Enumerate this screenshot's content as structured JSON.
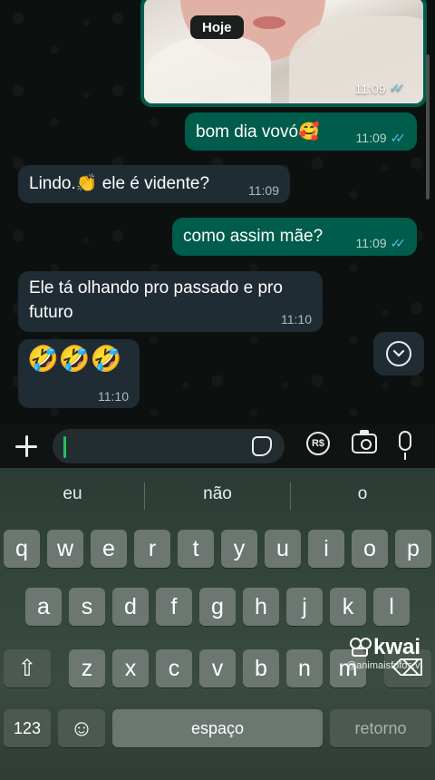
{
  "chat": {
    "date_chip": "Hoje",
    "photo_time": "11:09",
    "messages": [
      {
        "text": "bom dia vovó🥰",
        "time": "11:09",
        "direction": "outgoing",
        "ticks": "✓✓"
      },
      {
        "text": "Lindo.👏 ele é vidente?",
        "time": "11:09",
        "direction": "incoming"
      },
      {
        "text": "como assim mãe?",
        "time": "11:09",
        "direction": "outgoing",
        "ticks": "✓✓"
      },
      {
        "text": "Ele tá olhando pro passado e pro futuro",
        "time": "11:10",
        "direction": "incoming"
      },
      {
        "text": "🤣🤣🤣",
        "time": "11:10",
        "direction": "incoming"
      }
    ],
    "read_tick_color": "#53bdeb",
    "outgoing_color": "#005c4b",
    "incoming_color": "#202c33"
  },
  "input_bar": {
    "attach_icon": "plus-icon",
    "sticker_icon": "sticker-icon",
    "pay_label": "R$",
    "camera_icon": "camera-icon",
    "mic_icon": "microphone-icon",
    "cursor_color": "#21c063"
  },
  "keyboard": {
    "suggestions": [
      "eu",
      "não",
      "o"
    ],
    "row1": [
      "q",
      "w",
      "e",
      "r",
      "t",
      "y",
      "u",
      "i",
      "o",
      "p"
    ],
    "row2": [
      "a",
      "s",
      "d",
      "f",
      "g",
      "h",
      "j",
      "k",
      "l"
    ],
    "row3": [
      "z",
      "x",
      "c",
      "v",
      "b",
      "n",
      "m"
    ],
    "shift": "⇧",
    "backspace": "⌫",
    "numbers": "123",
    "emoji": "☺",
    "space": "espaço",
    "return": "retorno"
  },
  "watermark": {
    "brand": "kwai",
    "user": "@animaisfofos.v"
  }
}
